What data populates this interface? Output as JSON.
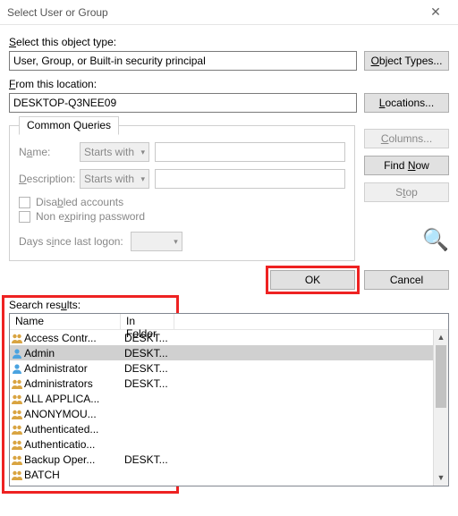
{
  "window": {
    "title": "Select User or Group"
  },
  "object_type": {
    "label_pre": "Select this object type:",
    "label_hot": "S",
    "value": "User, Group, or Built-in security principal",
    "button": "Object Types..."
  },
  "location": {
    "label_pre": "From this location:",
    "label_hot": "F",
    "value": "DESKTOP-Q3NEE09",
    "button": "Locations..."
  },
  "common_queries": {
    "tab": "Common Queries",
    "name_label": "Name:",
    "name_hot": "A",
    "desc_label": "Description:",
    "desc_hot": "D",
    "starts_with": "Starts with",
    "disabled_label": "Disabled accounts",
    "disabled_hot": "B",
    "nonexp_label": "Non expiring password",
    "nonexp_hot": "X",
    "days_label": "Days since last logon:",
    "days_hot": "I"
  },
  "side_buttons": {
    "columns": "Columns...",
    "find_now": "Find Now",
    "stop": "Stop"
  },
  "footer": {
    "ok": "OK",
    "cancel": "Cancel"
  },
  "search": {
    "label": "Search results:",
    "label_hot": "u",
    "columns": {
      "name": "Name",
      "folder": "In Folder"
    },
    "rows": [
      {
        "icon": "group",
        "name": "Access Contr...",
        "folder": "DESKT..."
      },
      {
        "icon": "user",
        "name": "Admin",
        "folder": "DESKT...",
        "selected": true
      },
      {
        "icon": "user",
        "name": "Administrator",
        "folder": "DESKT..."
      },
      {
        "icon": "group",
        "name": "Administrators",
        "folder": "DESKT..."
      },
      {
        "icon": "group",
        "name": "ALL APPLICA...",
        "folder": ""
      },
      {
        "icon": "group",
        "name": "ANONYMOU...",
        "folder": ""
      },
      {
        "icon": "group",
        "name": "Authenticated...",
        "folder": ""
      },
      {
        "icon": "group",
        "name": "Authenticatio...",
        "folder": ""
      },
      {
        "icon": "group",
        "name": "Backup Oper...",
        "folder": "DESKT..."
      },
      {
        "icon": "group",
        "name": "BATCH",
        "folder": ""
      }
    ]
  }
}
